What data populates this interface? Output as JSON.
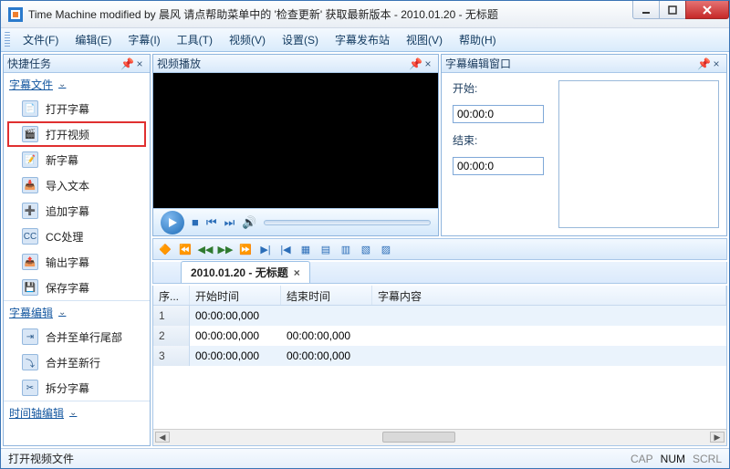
{
  "title": "Time Machine modified by 晨风 请点帮助菜单中的 '检查更新' 获取最新版本 - 2010.01.20 - 无标题",
  "menu": [
    "文件(F)",
    "编辑(E)",
    "字幕(I)",
    "工具(T)",
    "视频(V)",
    "设置(S)",
    "字幕发布站",
    "视图(V)",
    "帮助(H)"
  ],
  "panes": {
    "quick": {
      "title": "快捷任务"
    },
    "video": {
      "title": "视频播放"
    },
    "edit": {
      "title": "字幕编辑窗口"
    }
  },
  "sidebar": {
    "s1": {
      "title": "字幕文件",
      "items": [
        "打开字幕",
        "打开视频",
        "新字幕",
        "导入文本",
        "追加字幕",
        "CC处理",
        "输出字幕",
        "保存字幕"
      ],
      "highlight_index": 1
    },
    "s2": {
      "title": "字幕编辑",
      "items": [
        "合并至单行尾部",
        "合并至新行",
        "拆分字幕"
      ]
    },
    "s3": {
      "title": "时间轴编辑"
    }
  },
  "editpane": {
    "start_label": "开始:",
    "end_label": "结束:",
    "start_value": "00:00:0",
    "end_value": "00:00:0"
  },
  "tab": {
    "label": "2010.01.20 - 无标题"
  },
  "grid": {
    "cols": [
      "序...",
      "开始时间",
      "结束时间",
      "字幕内容"
    ],
    "rows": [
      {
        "n": "1",
        "s": "00:00:00,000",
        "e": "",
        "t": ""
      },
      {
        "n": "2",
        "s": "00:00:00,000",
        "e": "00:00:00,000",
        "t": ""
      },
      {
        "n": "3",
        "s": "00:00:00,000",
        "e": "00:00:00,000",
        "t": ""
      }
    ]
  },
  "status": {
    "hint": "打开视频文件",
    "cap": "CAP",
    "num": "NUM",
    "scrl": "SCRL"
  }
}
